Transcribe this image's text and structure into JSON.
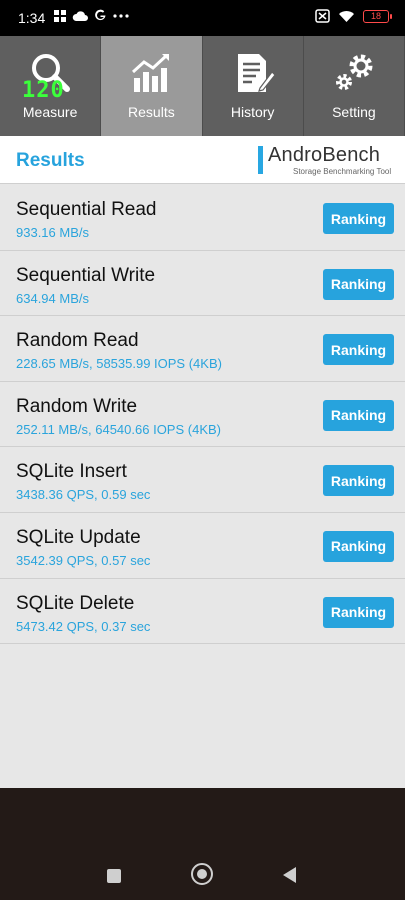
{
  "status_bar": {
    "time": "1:34",
    "battery": "18",
    "left_icons": [
      "gallery-icon",
      "cloud-icon",
      "google-icon",
      "more-icon"
    ],
    "right_icons": [
      "sim-off-icon",
      "wifi-icon",
      "battery-icon"
    ]
  },
  "fps_overlay": "120",
  "tabs": [
    {
      "label": "Measure",
      "icon": "magnifier-icon",
      "active": false
    },
    {
      "label": "Results",
      "icon": "chart-icon",
      "active": true
    },
    {
      "label": "History",
      "icon": "document-icon",
      "active": false
    },
    {
      "label": "Setting",
      "icon": "gears-icon",
      "active": false
    }
  ],
  "header": {
    "title": "Results",
    "logo_text": "AndroBench",
    "logo_subtitle": "Storage Benchmarking Tool"
  },
  "results": [
    {
      "title": "Sequential Read",
      "value": "933.16 MB/s",
      "button": "Ranking"
    },
    {
      "title": "Sequential Write",
      "value": "634.94 MB/s",
      "button": "Ranking"
    },
    {
      "title": "Random Read",
      "value": "228.65 MB/s, 58535.99 IOPS (4KB)",
      "button": "Ranking"
    },
    {
      "title": "Random Write",
      "value": "252.11 MB/s, 64540.66 IOPS (4KB)",
      "button": "Ranking"
    },
    {
      "title": "SQLite Insert",
      "value": "3438.36 QPS, 0.59 sec",
      "button": "Ranking"
    },
    {
      "title": "SQLite Update",
      "value": "3542.39 QPS, 0.57 sec",
      "button": "Ranking"
    },
    {
      "title": "SQLite Delete",
      "value": "5473.42 QPS, 0.37 sec",
      "button": "Ranking"
    }
  ],
  "colors": {
    "accent": "#27a3dd",
    "tab_bg": "#5f5f5f",
    "tab_active_bg": "#9a9a9a",
    "list_bg": "#e7e7e7",
    "nav_bg": "#231a17"
  }
}
